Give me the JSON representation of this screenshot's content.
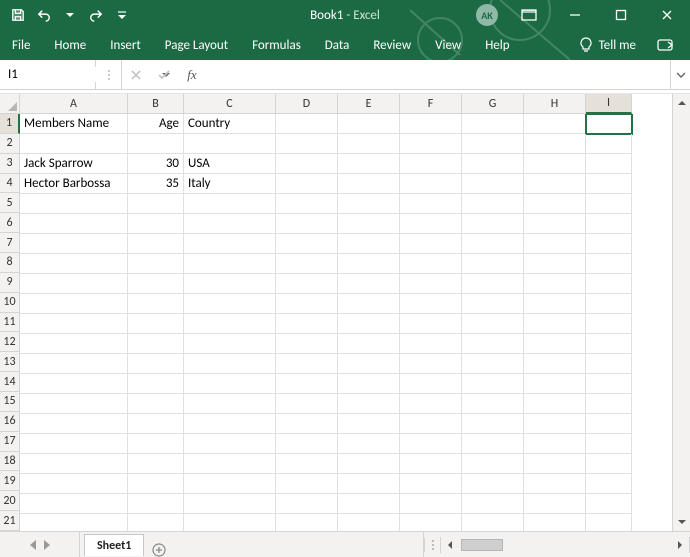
{
  "titlebar": {
    "title_main": "Book1",
    "title_sep": "  -  ",
    "title_app": "Excel",
    "avatar_initials": "AK"
  },
  "ribbon": {
    "tabs": [
      "File",
      "Home",
      "Insert",
      "Page Layout",
      "Formulas",
      "Data",
      "Review",
      "View",
      "Help"
    ],
    "tellme": "Tell me"
  },
  "formula_bar": {
    "name_box_value": "I1",
    "fx_label": "fx",
    "formula_value": ""
  },
  "grid": {
    "columns": [
      "A",
      "B",
      "C",
      "D",
      "E",
      "F",
      "G",
      "H",
      "I"
    ],
    "row_count": 21,
    "selected_cell": "I1",
    "selected_col_index": 8,
    "selected_row_index": 0,
    "cells": {
      "A1": "Members Name",
      "B1": "Age",
      "C1": "Country",
      "A3": "Jack Sparrow",
      "B3": "30",
      "C3": "USA",
      "A4": "Hector Barbossa",
      "B4": "35",
      "C4": "Italy"
    }
  },
  "sheet_tabs": {
    "active": "Sheet1"
  }
}
